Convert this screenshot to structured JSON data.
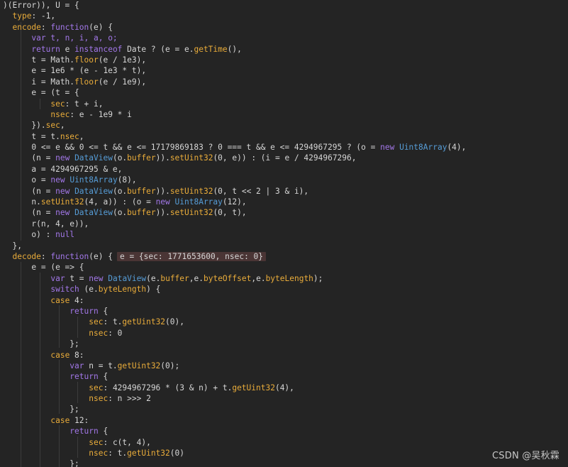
{
  "colors": {
    "background": "#242424",
    "text": "#d6d6d6",
    "property": "#e9ac3a",
    "keyword": "#a277e8",
    "type": "#569cd6",
    "inline_value_bg": "#4a3535",
    "indent_guide": "#3c3c3c"
  },
  "watermark": "CSDN @吴秋霖",
  "lines": [
    [
      {
        "t": ")(Error)), U = {",
        "c": "plain"
      }
    ],
    [
      {
        "t": "  ",
        "c": "plain"
      },
      {
        "t": "type",
        "c": "prop"
      },
      {
        "t": ": -1,",
        "c": "plain"
      }
    ],
    [
      {
        "t": "  ",
        "c": "plain"
      },
      {
        "t": "encode",
        "c": "prop"
      },
      {
        "t": ": ",
        "c": "plain"
      },
      {
        "t": "function",
        "c": "key"
      },
      {
        "t": "(e) {",
        "c": "plain"
      }
    ],
    [
      {
        "t": "      ",
        "c": "plain"
      },
      {
        "t": "var",
        "c": "key"
      },
      {
        "t": " t, n, i, a, o;",
        "c": "key"
      }
    ],
    [
      {
        "t": "      ",
        "c": "plain"
      },
      {
        "t": "return",
        "c": "key"
      },
      {
        "t": " e ",
        "c": "plain"
      },
      {
        "t": "instanceof",
        "c": "key"
      },
      {
        "t": " Date ? (e = e.",
        "c": "plain"
      },
      {
        "t": "getTime",
        "c": "prop"
      },
      {
        "t": "(),",
        "c": "plain"
      }
    ],
    [
      {
        "t": "      t = Math.",
        "c": "plain"
      },
      {
        "t": "floor",
        "c": "prop"
      },
      {
        "t": "(e / 1e3),",
        "c": "plain"
      }
    ],
    [
      {
        "t": "      e = 1e6 * (e - 1e3 * t),",
        "c": "plain"
      }
    ],
    [
      {
        "t": "      i = Math.",
        "c": "plain"
      },
      {
        "t": "floor",
        "c": "prop"
      },
      {
        "t": "(e / 1e9),",
        "c": "plain"
      }
    ],
    [
      {
        "t": "      e = (t = {",
        "c": "plain"
      }
    ],
    [
      {
        "t": "          ",
        "c": "plain"
      },
      {
        "t": "sec",
        "c": "prop"
      },
      {
        "t": ": t + i,",
        "c": "plain"
      }
    ],
    [
      {
        "t": "          ",
        "c": "plain"
      },
      {
        "t": "nsec",
        "c": "prop"
      },
      {
        "t": ": e - 1e9 * i",
        "c": "plain"
      }
    ],
    [
      {
        "t": "      }).",
        "c": "plain"
      },
      {
        "t": "sec",
        "c": "prop"
      },
      {
        "t": ",",
        "c": "plain"
      }
    ],
    [
      {
        "t": "      t = t.",
        "c": "plain"
      },
      {
        "t": "nsec",
        "c": "prop"
      },
      {
        "t": ",",
        "c": "plain"
      }
    ],
    [
      {
        "t": "      0 <= e && 0 <= t && e <= 17179869183 ? 0 === t && e <= 4294967295 ? (o = ",
        "c": "plain"
      },
      {
        "t": "new",
        "c": "key"
      },
      {
        "t": " ",
        "c": "plain"
      },
      {
        "t": "Uint8Array",
        "c": "type"
      },
      {
        "t": "(4),",
        "c": "plain"
      }
    ],
    [
      {
        "t": "      (n = ",
        "c": "plain"
      },
      {
        "t": "new",
        "c": "key"
      },
      {
        "t": " ",
        "c": "plain"
      },
      {
        "t": "DataView",
        "c": "type"
      },
      {
        "t": "(o.",
        "c": "plain"
      },
      {
        "t": "buffer",
        "c": "prop"
      },
      {
        "t": ")).",
        "c": "plain"
      },
      {
        "t": "setUint32",
        "c": "prop"
      },
      {
        "t": "(0, e)) : (i = e / 4294967296,",
        "c": "plain"
      }
    ],
    [
      {
        "t": "      a = 4294967295 & e,",
        "c": "plain"
      }
    ],
    [
      {
        "t": "      o = ",
        "c": "plain"
      },
      {
        "t": "new",
        "c": "key"
      },
      {
        "t": " ",
        "c": "plain"
      },
      {
        "t": "Uint8Array",
        "c": "type"
      },
      {
        "t": "(8),",
        "c": "plain"
      }
    ],
    [
      {
        "t": "      (n = ",
        "c": "plain"
      },
      {
        "t": "new",
        "c": "key"
      },
      {
        "t": " ",
        "c": "plain"
      },
      {
        "t": "DataView",
        "c": "type"
      },
      {
        "t": "(o.",
        "c": "plain"
      },
      {
        "t": "buffer",
        "c": "prop"
      },
      {
        "t": ")).",
        "c": "plain"
      },
      {
        "t": "setUint32",
        "c": "prop"
      },
      {
        "t": "(0, t << 2 | 3 & i),",
        "c": "plain"
      }
    ],
    [
      {
        "t": "      n.",
        "c": "plain"
      },
      {
        "t": "setUint32",
        "c": "prop"
      },
      {
        "t": "(4, a)) : (o = ",
        "c": "plain"
      },
      {
        "t": "new",
        "c": "key"
      },
      {
        "t": " ",
        "c": "plain"
      },
      {
        "t": "Uint8Array",
        "c": "type"
      },
      {
        "t": "(12),",
        "c": "plain"
      }
    ],
    [
      {
        "t": "      (n = ",
        "c": "plain"
      },
      {
        "t": "new",
        "c": "key"
      },
      {
        "t": " ",
        "c": "plain"
      },
      {
        "t": "DataView",
        "c": "type"
      },
      {
        "t": "(o.",
        "c": "plain"
      },
      {
        "t": "buffer",
        "c": "prop"
      },
      {
        "t": ")).",
        "c": "plain"
      },
      {
        "t": "setUint32",
        "c": "prop"
      },
      {
        "t": "(0, t),",
        "c": "plain"
      }
    ],
    [
      {
        "t": "      r(n, 4, e)),",
        "c": "plain"
      }
    ],
    [
      {
        "t": "      o) : ",
        "c": "plain"
      },
      {
        "t": "null",
        "c": "key"
      }
    ],
    [
      {
        "t": "  },",
        "c": "plain"
      }
    ],
    [
      {
        "t": "  ",
        "c": "plain"
      },
      {
        "t": "decode",
        "c": "prop"
      },
      {
        "t": ": ",
        "c": "plain"
      },
      {
        "t": "function",
        "c": "key"
      },
      {
        "t": "(e) {",
        "c": "plain"
      },
      {
        "t": "e = {sec: 1771653600, nsec: 0}",
        "c": "inline"
      }
    ],
    [
      {
        "t": "      e = (e => {",
        "c": "plain"
      }
    ],
    [
      {
        "t": "          ",
        "c": "plain"
      },
      {
        "t": "var",
        "c": "key"
      },
      {
        "t": " t = ",
        "c": "plain"
      },
      {
        "t": "new",
        "c": "key"
      },
      {
        "t": " ",
        "c": "plain"
      },
      {
        "t": "DataView",
        "c": "type"
      },
      {
        "t": "(e.",
        "c": "plain"
      },
      {
        "t": "buffer",
        "c": "prop"
      },
      {
        "t": ",e.",
        "c": "plain"
      },
      {
        "t": "byteOffset",
        "c": "prop"
      },
      {
        "t": ",e.",
        "c": "plain"
      },
      {
        "t": "byteLength",
        "c": "prop"
      },
      {
        "t": ");",
        "c": "plain"
      }
    ],
    [
      {
        "t": "          ",
        "c": "plain"
      },
      {
        "t": "switch",
        "c": "key"
      },
      {
        "t": " (e.",
        "c": "plain"
      },
      {
        "t": "byteLength",
        "c": "prop"
      },
      {
        "t": ") {",
        "c": "plain"
      }
    ],
    [
      {
        "t": "          ",
        "c": "plain"
      },
      {
        "t": "case",
        "c": "prop"
      },
      {
        "t": " 4:",
        "c": "plain"
      }
    ],
    [
      {
        "t": "              ",
        "c": "plain"
      },
      {
        "t": "return",
        "c": "key"
      },
      {
        "t": " {",
        "c": "plain"
      }
    ],
    [
      {
        "t": "                  ",
        "c": "plain"
      },
      {
        "t": "sec",
        "c": "prop"
      },
      {
        "t": ": t.",
        "c": "plain"
      },
      {
        "t": "getUint32",
        "c": "prop"
      },
      {
        "t": "(0),",
        "c": "plain"
      }
    ],
    [
      {
        "t": "                  ",
        "c": "plain"
      },
      {
        "t": "nsec",
        "c": "prop"
      },
      {
        "t": ": 0",
        "c": "plain"
      }
    ],
    [
      {
        "t": "              };",
        "c": "plain"
      }
    ],
    [
      {
        "t": "          ",
        "c": "plain"
      },
      {
        "t": "case",
        "c": "prop"
      },
      {
        "t": " 8:",
        "c": "plain"
      }
    ],
    [
      {
        "t": "              ",
        "c": "plain"
      },
      {
        "t": "var",
        "c": "key"
      },
      {
        "t": " n = t.",
        "c": "plain"
      },
      {
        "t": "getUint32",
        "c": "prop"
      },
      {
        "t": "(0);",
        "c": "plain"
      }
    ],
    [
      {
        "t": "              ",
        "c": "plain"
      },
      {
        "t": "return",
        "c": "key"
      },
      {
        "t": " {",
        "c": "plain"
      }
    ],
    [
      {
        "t": "                  ",
        "c": "plain"
      },
      {
        "t": "sec",
        "c": "prop"
      },
      {
        "t": ": 4294967296 * (3 & n) + t.",
        "c": "plain"
      },
      {
        "t": "getUint32",
        "c": "prop"
      },
      {
        "t": "(4),",
        "c": "plain"
      }
    ],
    [
      {
        "t": "                  ",
        "c": "plain"
      },
      {
        "t": "nsec",
        "c": "prop"
      },
      {
        "t": ": n >>> 2",
        "c": "plain"
      }
    ],
    [
      {
        "t": "              };",
        "c": "plain"
      }
    ],
    [
      {
        "t": "          ",
        "c": "plain"
      },
      {
        "t": "case",
        "c": "prop"
      },
      {
        "t": " 12:",
        "c": "plain"
      }
    ],
    [
      {
        "t": "              ",
        "c": "plain"
      },
      {
        "t": "return",
        "c": "key"
      },
      {
        "t": " {",
        "c": "plain"
      }
    ],
    [
      {
        "t": "                  ",
        "c": "plain"
      },
      {
        "t": "sec",
        "c": "prop"
      },
      {
        "t": ": c(t, 4),",
        "c": "plain"
      }
    ],
    [
      {
        "t": "                  ",
        "c": "plain"
      },
      {
        "t": "nsec",
        "c": "prop"
      },
      {
        "t": ": t.",
        "c": "plain"
      },
      {
        "t": "getUint32",
        "c": "prop"
      },
      {
        "t": "(0)",
        "c": "plain"
      }
    ],
    [
      {
        "t": "              };",
        "c": "plain"
      }
    ]
  ]
}
